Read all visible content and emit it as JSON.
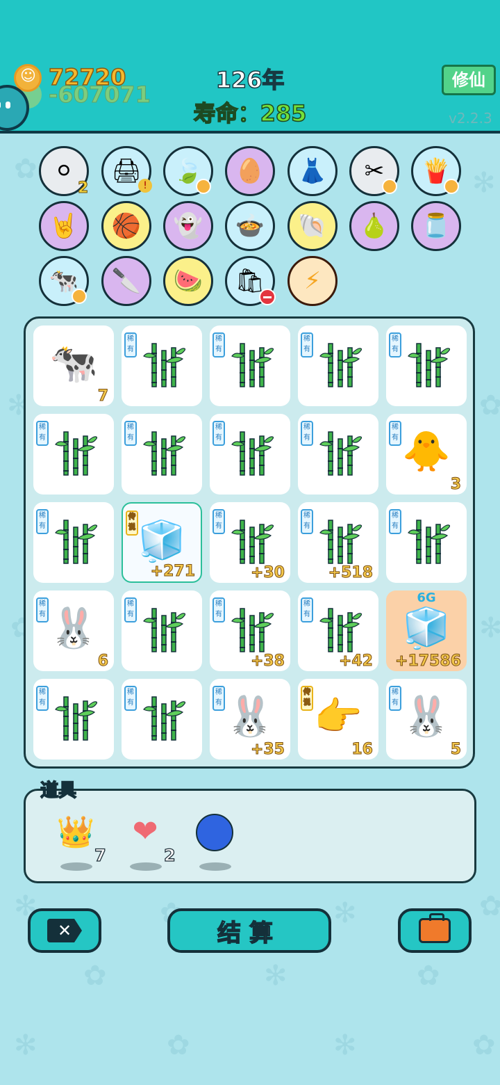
{
  "header": {
    "gold": "72720",
    "debt": "-607071",
    "year": "126年",
    "lifespan": "寿命：285",
    "cultivate_label": "修仙",
    "version": "v2.2.3"
  },
  "items": [
    {
      "icon": "egg-tray-icon",
      "count": "2"
    },
    {
      "icon": "printer-icon"
    },
    {
      "icon": "leaf-icon"
    },
    {
      "icon": "boiled-egg-icon"
    },
    {
      "icon": "skirt-icon"
    },
    {
      "icon": "scissors-icon"
    },
    {
      "icon": "fries-icon"
    },
    {
      "icon": "rock-hand-icon"
    },
    {
      "icon": "basketballs-icon"
    },
    {
      "icon": "ghost-icon"
    },
    {
      "icon": "pot-icon"
    },
    {
      "icon": "shell-icon"
    },
    {
      "icon": "pear-icon"
    },
    {
      "icon": "jar-icon"
    },
    {
      "icon": "cows-icon"
    },
    {
      "icon": "cleaver-icon"
    },
    {
      "icon": "fruit-basket-icon"
    },
    {
      "icon": "sack-icon"
    },
    {
      "icon": "lightning-icon"
    }
  ],
  "board": {
    "rows": [
      [
        {
          "kind": "cow",
          "tag": "",
          "num": "7"
        },
        {
          "kind": "bamboo",
          "tag": "稀有",
          "num": ""
        },
        {
          "kind": "bamboo",
          "tag": "稀有",
          "num": ""
        },
        {
          "kind": "bamboo",
          "tag": "稀有",
          "num": ""
        },
        {
          "kind": "bamboo",
          "tag": "稀有",
          "num": ""
        }
      ],
      [
        {
          "kind": "bamboo",
          "tag": "稀有",
          "num": ""
        },
        {
          "kind": "bamboo",
          "tag": "稀有",
          "num": ""
        },
        {
          "kind": "bamboo",
          "tag": "稀有",
          "num": ""
        },
        {
          "kind": "bamboo",
          "tag": "稀有",
          "num": ""
        },
        {
          "kind": "chick",
          "tag": "稀有",
          "num": "3"
        }
      ],
      [
        {
          "kind": "bamboo",
          "tag": "稀有",
          "num": ""
        },
        {
          "kind": "fridge-king",
          "tag": "传说",
          "num": "+271"
        },
        {
          "kind": "bamboo",
          "tag": "稀有",
          "num": "+30"
        },
        {
          "kind": "bamboo",
          "tag": "稀有",
          "num": "+518"
        },
        {
          "kind": "bamboo",
          "tag": "稀有",
          "num": ""
        }
      ],
      [
        {
          "kind": "rabbit",
          "tag": "稀有",
          "num": "6"
        },
        {
          "kind": "bamboo",
          "tag": "稀有",
          "num": ""
        },
        {
          "kind": "bamboo",
          "tag": "稀有",
          "num": "+38"
        },
        {
          "kind": "bamboo",
          "tag": "稀有",
          "num": "+42"
        },
        {
          "kind": "fridge-6g",
          "tag": "",
          "num": "+17586",
          "badge": "6G"
        }
      ],
      [
        {
          "kind": "bamboo",
          "tag": "稀有",
          "num": ""
        },
        {
          "kind": "bamboo",
          "tag": "稀有",
          "num": ""
        },
        {
          "kind": "rabbit",
          "tag": "稀有",
          "num": "+35"
        },
        {
          "kind": "pointing-hand",
          "tag": "传说",
          "num": "16"
        },
        {
          "kind": "rabbit",
          "tag": "稀有",
          "num": "5"
        }
      ]
    ]
  },
  "props": {
    "label": "道具",
    "items": [
      {
        "icon": "crown-icon",
        "count": "7"
      },
      {
        "icon": "liver-icon",
        "count": "2"
      },
      {
        "icon": "blueberry-icon",
        "count": ""
      }
    ]
  },
  "buttons": {
    "settle": "结算"
  },
  "colors": {
    "header": "#21c6c5",
    "background": "#aee4ec",
    "button": "#25c6c4"
  }
}
